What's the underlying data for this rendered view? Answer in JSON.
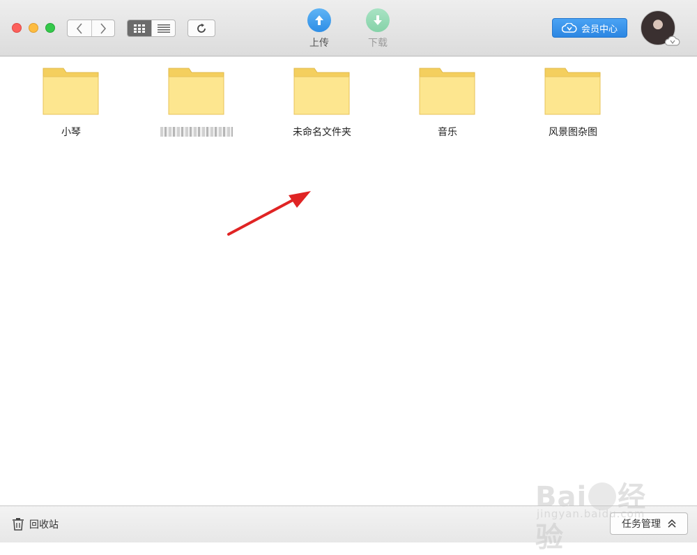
{
  "toolbar": {
    "upload_label": "上传",
    "download_label": "下载",
    "vip_label": "会员中心"
  },
  "folders": [
    {
      "name": "小琴"
    },
    {
      "name": ""
    },
    {
      "name": "未命名文件夹"
    },
    {
      "name": "音乐"
    },
    {
      "name": "风景图杂图"
    }
  ],
  "statusbar": {
    "trash_label": "回收站",
    "task_label": "任务管理"
  },
  "watermark": {
    "logo_text": "Bai du经验",
    "sub_text": "jingyan.baidu.com"
  },
  "colors": {
    "accent_blue": "#2e8ee6",
    "download_green": "#85d2a8",
    "folder_yellow": "#fde68f",
    "arrow_red": "#e02424"
  }
}
